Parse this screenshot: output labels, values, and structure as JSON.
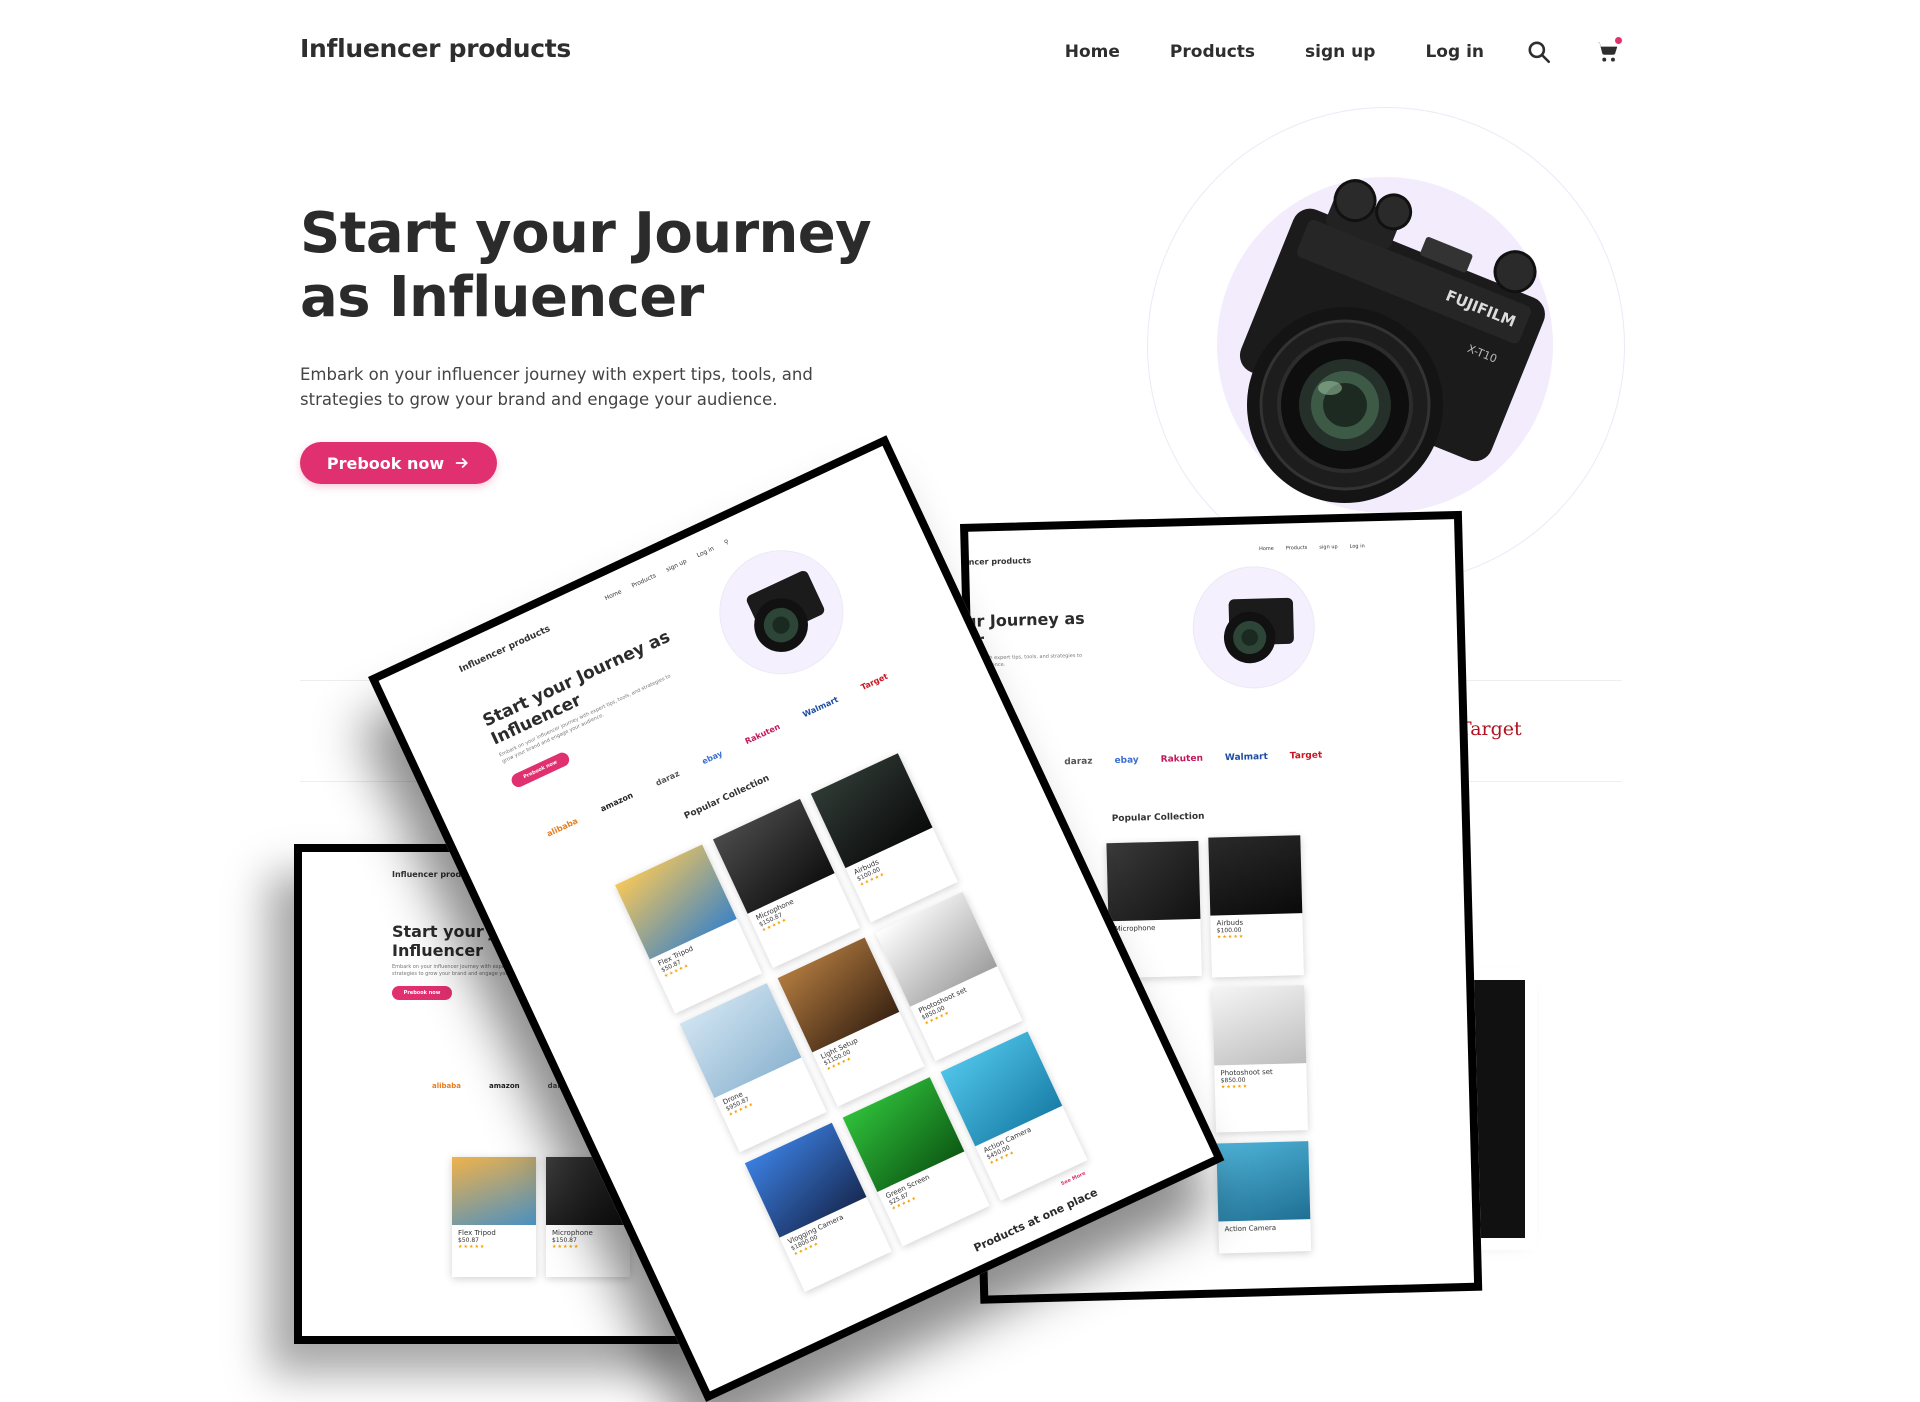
{
  "header": {
    "brand": "Influencer products",
    "nav": [
      {
        "label": "Home"
      },
      {
        "label": "Products"
      },
      {
        "label": "sign up"
      },
      {
        "label": "Log in"
      }
    ],
    "icons": [
      "search-icon",
      "cart-icon"
    ]
  },
  "hero": {
    "title": "Start your Journey as Influencer",
    "description": "Embark on your influencer journey with expert tips, tools, and strategies to grow your brand and engage your audience.",
    "cta_label": "Prebook now",
    "cta_icon": "arrow-right-icon"
  },
  "retailers": {
    "visible": "Target"
  },
  "mockup": {
    "brand": "Influencer products",
    "nav": [
      "Home",
      "Products",
      "sign up",
      "Log in"
    ],
    "title": "Start your Journey as Influencer",
    "subtitle": "Embark on your influencer journey with expert tips, tools, and strategies to grow your brand and engage your audience.",
    "cta": "Prebook now",
    "logos": [
      "alibaba",
      "amazon",
      "daraz",
      "ebay",
      "Rakuten",
      "Walmart",
      "Target"
    ],
    "section_title": "Popular Collection",
    "see_all": "See More",
    "bottom_title": "Products at one place",
    "products": [
      {
        "name": "Flex Tripod",
        "price": "$50.87",
        "rating": "4.6"
      },
      {
        "name": "Microphone",
        "price": "$150.87",
        "rating": "4.6"
      },
      {
        "name": "Airbuds",
        "price": "$100.00",
        "rating": "4.6"
      },
      {
        "name": "Drone",
        "price": "$950.87",
        "rating": "4.6"
      },
      {
        "name": "Light Setup",
        "price": "$1150.00",
        "rating": "4.6"
      },
      {
        "name": "Photoshoot set",
        "price": "$850.00",
        "rating": "4.6"
      },
      {
        "name": "Vlogging Camera",
        "price": "$1800.00",
        "rating": "4.6"
      },
      {
        "name": "Green Screen",
        "price": "$25.87",
        "rating": "4.6"
      },
      {
        "name": "Action Camera",
        "price": "$450.00",
        "rating": "4.6"
      }
    ]
  },
  "colors": {
    "accent": "#e0306f",
    "text": "#2b2b2b",
    "hero_circle": "#f2ecfc",
    "target_red": "#b0101f"
  }
}
